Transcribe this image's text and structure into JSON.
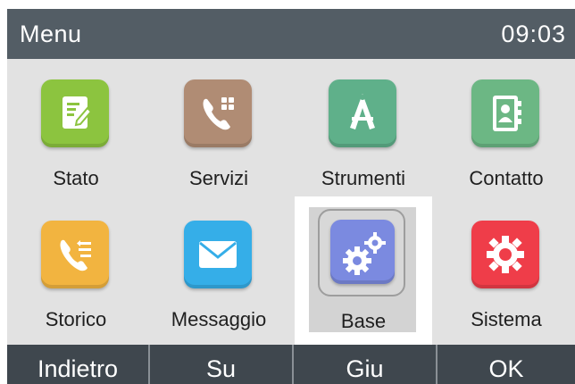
{
  "header": {
    "title": "Menu",
    "time": "09:03"
  },
  "menu": {
    "selected_index": 6,
    "items": [
      {
        "label": "Stato",
        "icon": "status-doc-icon",
        "color": "#8cc43f"
      },
      {
        "label": "Servizi",
        "icon": "phone-services-icon",
        "color": "#b08c74"
      },
      {
        "label": "Strumenti",
        "icon": "tools-icon",
        "color": "#5fb08a"
      },
      {
        "label": "Contatto",
        "icon": "contact-book-icon",
        "color": "#6cb784"
      },
      {
        "label": "Storico",
        "icon": "call-history-icon",
        "color": "#f2b440"
      },
      {
        "label": "Messaggio",
        "icon": "envelope-icon",
        "color": "#35aee8"
      },
      {
        "label": "Base",
        "icon": "gears-icon",
        "color": "#7b8ae0"
      },
      {
        "label": "Sistema",
        "icon": "system-gear-icon",
        "color": "#ef3d49"
      }
    ]
  },
  "softkeys": [
    "Indietro",
    "Su",
    "Giu",
    "OK"
  ],
  "colors": {
    "titlebar": "#535d65",
    "softkey_bar": "#3f474e",
    "background": "#e2e2e2",
    "highlight": "#ffffff"
  }
}
